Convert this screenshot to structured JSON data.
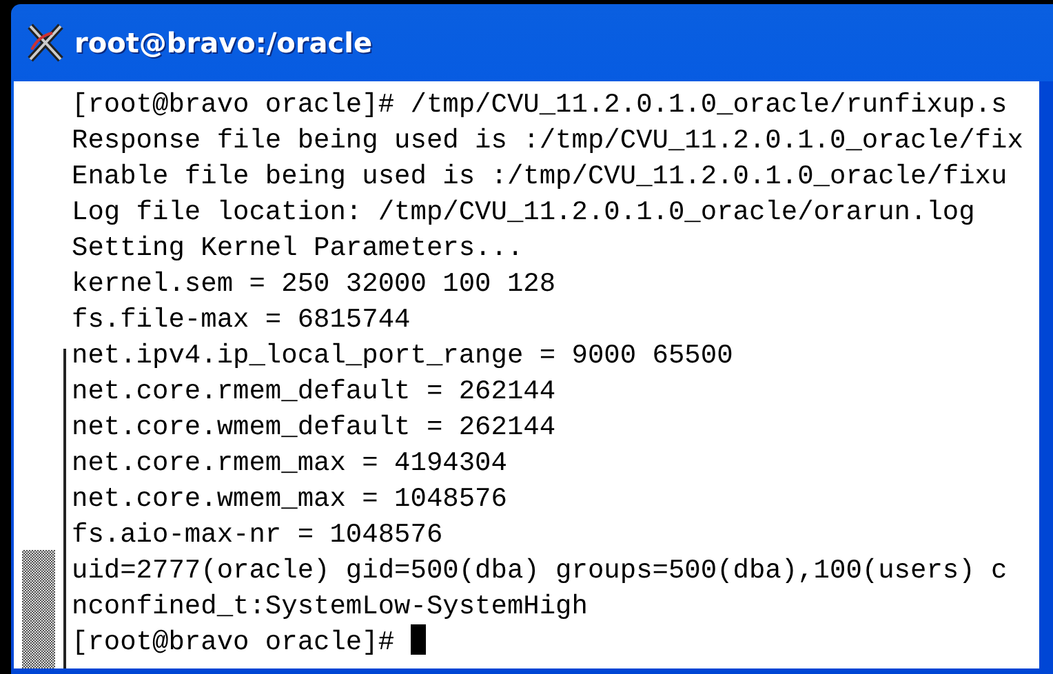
{
  "window": {
    "title": "root@bravo:/oracle"
  },
  "terminal": {
    "lines": [
      "[root@bravo oracle]# /tmp/CVU_11.2.0.1.0_oracle/runfixup.s",
      "Response file being used is :/tmp/CVU_11.2.0.1.0_oracle/fix",
      "Enable file being used is :/tmp/CVU_11.2.0.1.0_oracle/fixu",
      "Log file location: /tmp/CVU_11.2.0.1.0_oracle/orarun.log",
      "Setting Kernel Parameters...",
      "kernel.sem = 250 32000 100 128",
      "fs.file-max = 6815744",
      "net.ipv4.ip_local_port_range = 9000 65500",
      "net.core.rmem_default = 262144",
      "net.core.wmem_default = 262144",
      "net.core.rmem_max = 4194304",
      "net.core.wmem_max = 1048576",
      "fs.aio-max-nr = 1048576",
      "uid=2777(oracle) gid=500(dba) groups=500(dba),100(users) c",
      "nconfined_t:SystemLow-SystemHigh",
      "[root@bravo oracle]# "
    ]
  }
}
